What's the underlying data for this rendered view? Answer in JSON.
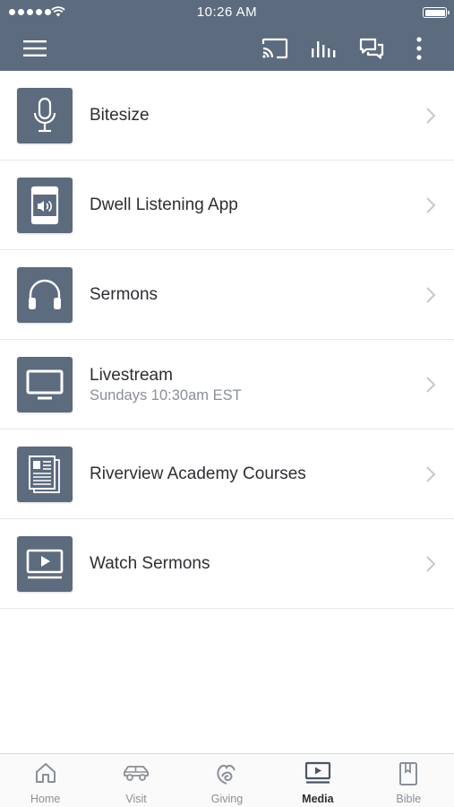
{
  "status_bar": {
    "time": "10:26 AM"
  },
  "app_bar": {
    "icons": [
      "menu-icon",
      "cast-icon",
      "audio-bars-icon",
      "chat-icon",
      "more-vertical-icon"
    ]
  },
  "list": [
    {
      "title": "Bitesize",
      "subtitle": "",
      "icon": "microphone-icon"
    },
    {
      "title": "Dwell Listening App",
      "subtitle": "",
      "icon": "audio-book-icon"
    },
    {
      "title": "Sermons",
      "subtitle": "",
      "icon": "headphones-icon"
    },
    {
      "title": "Livestream",
      "subtitle": "Sundays 10:30am EST",
      "icon": "monitor-icon"
    },
    {
      "title": "Riverview Academy Courses",
      "subtitle": "",
      "icon": "newspaper-icon"
    },
    {
      "title": "Watch Sermons",
      "subtitle": "",
      "icon": "video-player-icon"
    }
  ],
  "tabs": [
    {
      "label": "Home",
      "icon": "home-icon",
      "active": false
    },
    {
      "label": "Visit",
      "icon": "car-icon",
      "active": false
    },
    {
      "label": "Giving",
      "icon": "giving-icon",
      "active": false
    },
    {
      "label": "Media",
      "icon": "media-icon",
      "active": true
    },
    {
      "label": "Bible",
      "icon": "bible-icon",
      "active": false
    }
  ],
  "colors": {
    "brand": "#5c6b7e",
    "text": "#2c2f33",
    "muted": "#8a8f96"
  }
}
